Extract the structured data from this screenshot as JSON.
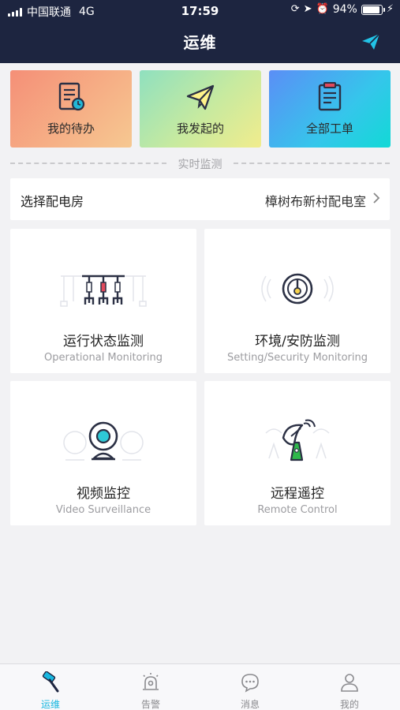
{
  "status_bar": {
    "carrier": "中国联通",
    "network": "4G",
    "time": "17:59",
    "battery": "94%",
    "battery_level": 0.94
  },
  "nav": {
    "title": "运维",
    "action_icon": "paper-plane-icon"
  },
  "quick_actions": [
    {
      "label": "我的待办",
      "icon": "todo-clock-icon"
    },
    {
      "label": "我发起的",
      "icon": "paper-plane-icon"
    },
    {
      "label": "全部工单",
      "icon": "clipboard-list-icon"
    }
  ],
  "section": {
    "title": "实时监测"
  },
  "room_selector": {
    "label": "选择配电房",
    "value": "樟树布新村配电室"
  },
  "modules": [
    {
      "title": "运行状态监测",
      "subtitle": "Operational Monitoring",
      "icon": "switchgear-icon"
    },
    {
      "title": "环境/安防监测",
      "subtitle": "Setting/Security Monitoring",
      "icon": "sensor-icon"
    },
    {
      "title": "视频监控",
      "subtitle": "Video Surveillance",
      "icon": "webcam-icon"
    },
    {
      "title": "远程遥控",
      "subtitle": "Remote Control",
      "icon": "satellite-dish-icon"
    }
  ],
  "tab_bar": [
    {
      "label": "运维",
      "icon": "hammer-icon",
      "active": true
    },
    {
      "label": "告警",
      "icon": "alarm-icon",
      "active": false
    },
    {
      "label": "消息",
      "icon": "chat-bubble-icon",
      "active": false
    },
    {
      "label": "我的",
      "icon": "person-icon",
      "active": false
    }
  ],
  "colors": {
    "header_bg": "#1d2540",
    "accent": "#18b7e0",
    "page_bg": "#f2f2f4",
    "icon_dark": "#2b3044",
    "icon_red": "#e2495b",
    "icon_teal": "#2ec9d6",
    "icon_green": "#2fb84b"
  }
}
